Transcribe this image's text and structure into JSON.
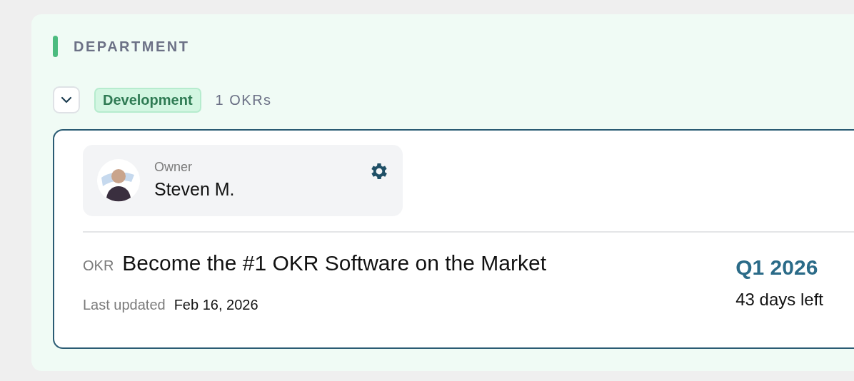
{
  "section": {
    "title": "DEPARTMENT"
  },
  "group": {
    "expanded": true,
    "tag": "Development",
    "count": "1 OKRs"
  },
  "okr_card": {
    "owner": {
      "label": "Owner",
      "name": "Steven M."
    },
    "prefix": "OKR",
    "title": "Become the #1 OKR Software on the Market",
    "updated_label": "Last updated",
    "updated_date": "Feb 16, 2026",
    "quarter": "Q1 2026",
    "remaining": "43 days left"
  }
}
